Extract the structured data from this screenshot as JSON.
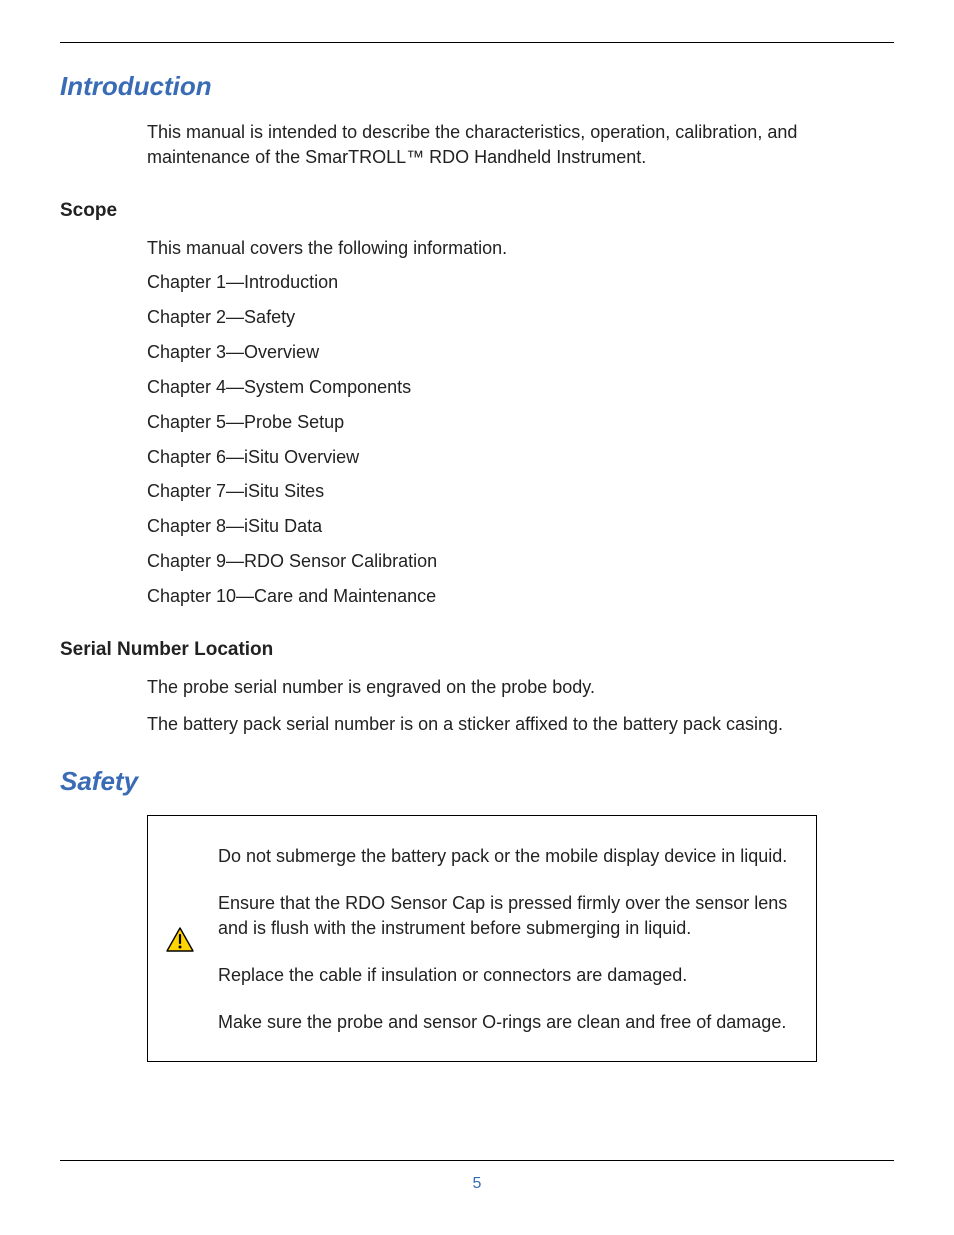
{
  "headings": {
    "introduction": "Introduction",
    "scope": "Scope",
    "serial": "Serial Number Location",
    "safety": "Safety"
  },
  "intro": {
    "p1": "This manual is intended to describe the characteristics, operation, calibration, and maintenance of the SmarTROLL™ RDO Handheld Instrument."
  },
  "scope": {
    "lead": "This manual covers the following information.",
    "chapters": [
      "Chapter 1—Introduction",
      "Chapter 2—Safety",
      "Chapter 3—Overview",
      "Chapter 4—System Components",
      "Chapter 5—Probe Setup",
      "Chapter 6—iSitu Overview",
      "Chapter 7—iSitu Sites",
      "Chapter 8—iSitu Data",
      "Chapter 9—RDO Sensor Calibration",
      "Chapter 10—Care and Maintenance"
    ]
  },
  "serial": {
    "p1": "The probe serial number is engraved on the probe body.",
    "p2": "The battery pack serial number is on a sticker affixed to the battery pack casing."
  },
  "safetyBox": {
    "p1": "Do not submerge the battery pack or the mobile display device in liquid.",
    "p2": "Ensure that the RDO Sensor Cap is pressed firmly over the sensor lens and is flush with the instrument before submerging in liquid.",
    "p3": "Replace the cable if insulation or connectors are damaged.",
    "p4": "Make sure the probe and sensor O-rings are clean and free of damage."
  },
  "pageNumber": "5"
}
